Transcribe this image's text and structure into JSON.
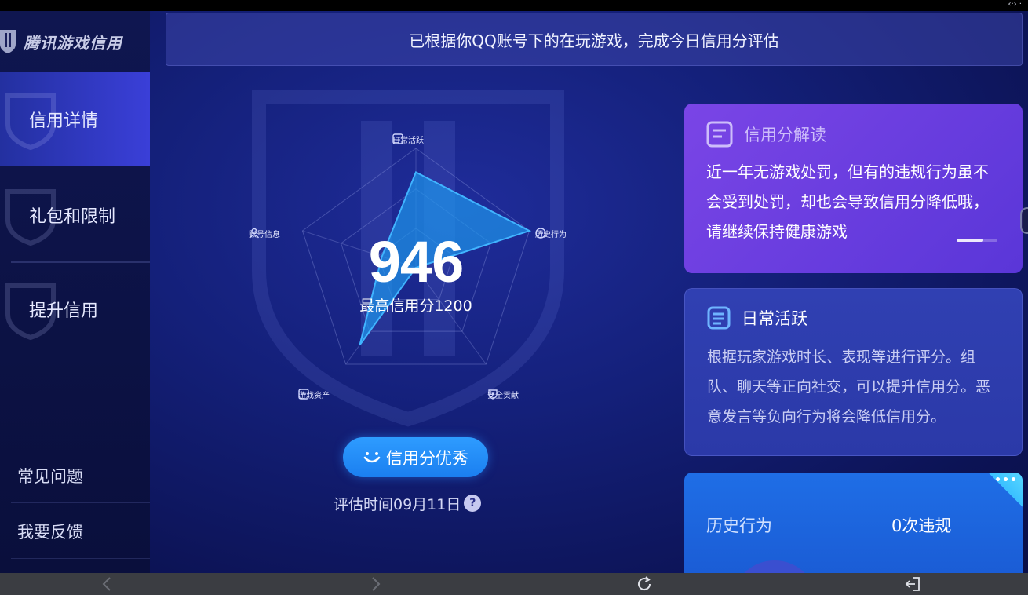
{
  "brand": {
    "title": "腾讯游戏信用"
  },
  "sidebar": {
    "items": [
      {
        "label": "信用详情"
      },
      {
        "label": "礼包和限制"
      },
      {
        "label": "提升信用"
      }
    ],
    "bottom": [
      {
        "label": "常见问题"
      },
      {
        "label": "我要反馈"
      }
    ]
  },
  "banner": {
    "text": "已根据你QQ账号下的在玩游戏，完成今日信用分评估"
  },
  "radar": {
    "axes": [
      "日常活跃",
      "历史行为",
      "安全贡献",
      "游戏资产",
      "账号信息"
    ],
    "values": [
      0.8,
      1.0,
      0.0,
      0.8,
      0.3
    ],
    "score": "946",
    "max_score": "最高信用分1200"
  },
  "grade_button": {
    "label": "信用分优秀"
  },
  "eval_time": {
    "text": "评估时间09月11日",
    "help": "?"
  },
  "cards": {
    "interpret": {
      "title": "信用分解读",
      "body": "近一年无游戏处罚，但有的违规行为虽不会受到处罚，却也会导致信用分降低哦，请继续保持健康游戏"
    },
    "daily": {
      "title": "日常活跃",
      "body": "根据玩家游戏时长、表现等进行评分。组队、聊天等正向社交，可以提升信用分。恶意发言等负向行为将会降低信用分。"
    },
    "history": {
      "label": "历史行为",
      "value": "0次违规",
      "badge": "•••"
    }
  },
  "colors": {
    "accent": "#2e9cff",
    "interpret_card": "#6a3ee0",
    "history_card": "#1f6ee6",
    "radar_fill": "#1e8fe0"
  },
  "icons": [
    "back-icon",
    "forward-icon",
    "refresh-icon",
    "exit-icon"
  ]
}
